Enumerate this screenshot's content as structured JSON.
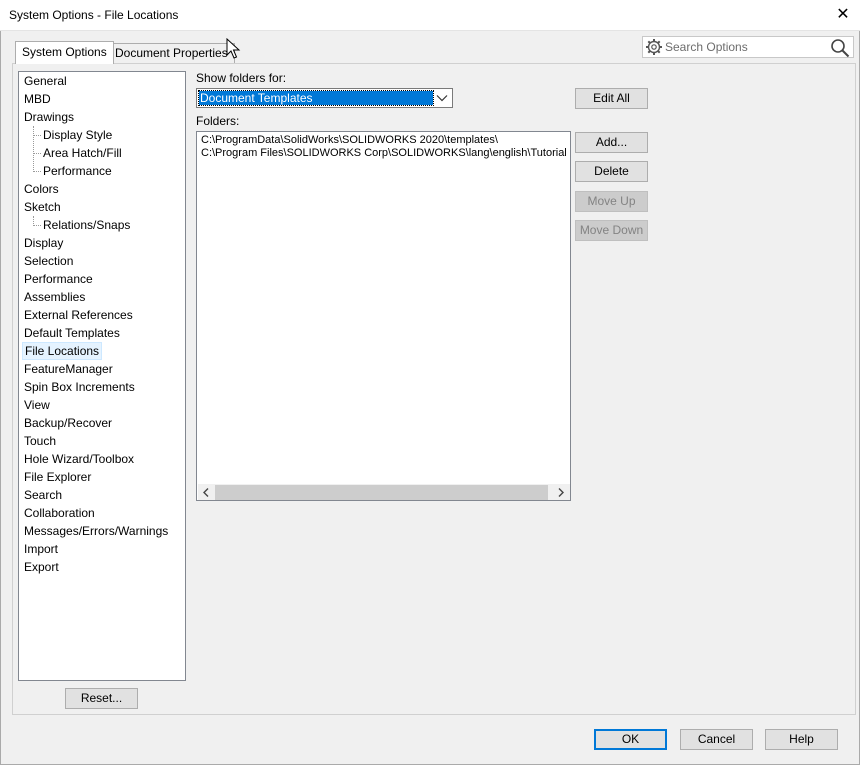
{
  "window": {
    "title": "System Options - File Locations",
    "close_glyph": "✕"
  },
  "tabs": [
    {
      "label": "System Options",
      "active": true
    },
    {
      "label": "Document Properties",
      "active": false
    }
  ],
  "search": {
    "placeholder": "Search Options"
  },
  "tree": {
    "items": [
      {
        "label": "General",
        "level": 0
      },
      {
        "label": "MBD",
        "level": 0
      },
      {
        "label": "Drawings",
        "level": 0
      },
      {
        "label": "Display Style",
        "level": 1
      },
      {
        "label": "Area Hatch/Fill",
        "level": 1
      },
      {
        "label": "Performance",
        "level": 1
      },
      {
        "label": "Colors",
        "level": 0
      },
      {
        "label": "Sketch",
        "level": 0
      },
      {
        "label": "Relations/Snaps",
        "level": 1
      },
      {
        "label": "Display",
        "level": 0
      },
      {
        "label": "Selection",
        "level": 0
      },
      {
        "label": "Performance",
        "level": 0
      },
      {
        "label": "Assemblies",
        "level": 0
      },
      {
        "label": "External References",
        "level": 0
      },
      {
        "label": "Default Templates",
        "level": 0
      },
      {
        "label": "File Locations",
        "level": 0,
        "selected": true
      },
      {
        "label": "FeatureManager",
        "level": 0
      },
      {
        "label": "Spin Box Increments",
        "level": 0
      },
      {
        "label": "View",
        "level": 0
      },
      {
        "label": "Backup/Recover",
        "level": 0
      },
      {
        "label": "Touch",
        "level": 0
      },
      {
        "label": "Hole Wizard/Toolbox",
        "level": 0
      },
      {
        "label": "File Explorer",
        "level": 0
      },
      {
        "label": "Search",
        "level": 0
      },
      {
        "label": "Collaboration",
        "level": 0
      },
      {
        "label": "Messages/Errors/Warnings",
        "level": 0
      },
      {
        "label": "Import",
        "level": 0
      },
      {
        "label": "Export",
        "level": 0
      }
    ]
  },
  "reset_label": "Reset...",
  "show_folders": {
    "label": "Show folders for:",
    "selected": "Document Templates"
  },
  "folders": {
    "label": "Folders:",
    "paths": [
      "C:\\ProgramData\\SolidWorks\\SOLIDWORKS 2020\\templates\\",
      "C:\\Program Files\\SOLIDWORKS Corp\\SOLIDWORKS\\lang\\english\\Tutorial"
    ]
  },
  "buttons": {
    "edit_all": "Edit All",
    "add": "Add...",
    "delete": "Delete",
    "move_up": "Move Up",
    "move_down": "Move Down"
  },
  "footer": {
    "ok": "OK",
    "cancel": "Cancel",
    "help": "Help"
  },
  "colors": {
    "selection": "#0078d7",
    "tree_selected_bg": "#e5f3ff"
  }
}
